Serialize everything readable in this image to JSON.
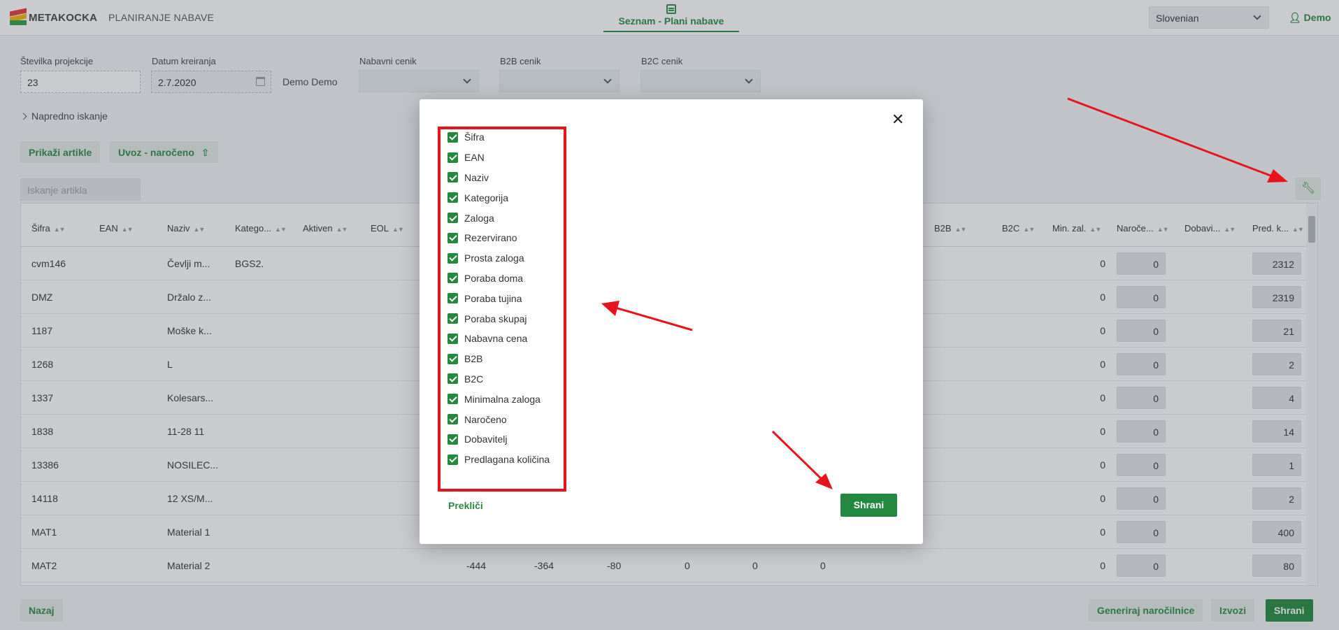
{
  "header": {
    "logo_text": "METAKOCKA",
    "app_title": "PLANIRANJE NABAVE",
    "nav_label": "Seznam - Plani nabave",
    "language": "Slovenian",
    "user": "Demo"
  },
  "filters": {
    "projection_label": "Številka projekcije",
    "projection_value": "23",
    "date_label": "Datum kreiranja",
    "date_value": "2.7.2020",
    "creator": "Demo Demo",
    "purchase_pricelist_label": "Nabavni cenik",
    "b2b_pricelist_label": "B2B cenik",
    "b2c_pricelist_label": "B2C cenik",
    "advanced_search": "Napredno iskanje"
  },
  "actions": {
    "show_items": "Prikaži artikle",
    "import_ordered": "Uvoz - naročeno",
    "search_placeholder": "Iskanje artikla"
  },
  "table": {
    "headers": [
      "Šifra",
      "EAN",
      "Naziv",
      "Katego...",
      "Aktiven",
      "EOL",
      "B2B",
      "B2C",
      "Min. zal.",
      "Naroče...",
      "Dobavi...",
      "Pred. k..."
    ],
    "rows": [
      {
        "sifra": "cvm146",
        "naziv": "Čevlji m...",
        "kategorija": "BGS2.",
        "min": "0",
        "naroceno": "0",
        "pred": "2312"
      },
      {
        "sifra": "DMZ",
        "naziv": "Držalo z...",
        "kategorija": "",
        "min": "0",
        "naroceno": "0",
        "pred": "2319"
      },
      {
        "sifra": "1187",
        "naziv": "Moške k...",
        "kategorija": "",
        "min": "0",
        "naroceno": "0",
        "pred": "21"
      },
      {
        "sifra": "1268",
        "naziv": "L",
        "kategorija": "",
        "min": "0",
        "naroceno": "0",
        "pred": "2"
      },
      {
        "sifra": "1337",
        "naziv": "Kolesars...",
        "kategorija": "",
        "min": "0",
        "naroceno": "0",
        "pred": "4"
      },
      {
        "sifra": "1838",
        "naziv": "11-28 11",
        "kategorija": "",
        "min": "0",
        "naroceno": "0",
        "pred": "14"
      },
      {
        "sifra": "13386",
        "naziv": "NOSILEC...",
        "kategorija": "",
        "min": "0",
        "naroceno": "0",
        "pred": "1"
      },
      {
        "sifra": "14118",
        "naziv": "12 XS/M...",
        "kategorija": "",
        "min": "0",
        "naroceno": "0",
        "pred": "2"
      },
      {
        "sifra": "MAT1",
        "naziv": "Material 1",
        "kategorija": "",
        "min": "0",
        "naroceno": "0",
        "pred": "400"
      },
      {
        "sifra": "MAT2",
        "naziv": "Material 2",
        "kategorija": "",
        "min": "0",
        "naroceno": "0",
        "pred": "80"
      }
    ],
    "mat2_extra": [
      "-444",
      "-364",
      "-80",
      "0",
      "0",
      "0"
    ]
  },
  "footer": {
    "back": "Nazaj",
    "generate_orders": "Generiraj naročilnice",
    "export": "Izvozi",
    "save": "Shrani"
  },
  "modal": {
    "columns": [
      "Šifra",
      "EAN",
      "Naziv",
      "Kategorija",
      "Zaloga",
      "Rezervirano",
      "Prosta zaloga",
      "Poraba doma",
      "Poraba tujina",
      "Poraba skupaj",
      "Nabavna cena",
      "B2B",
      "B2C",
      "Minimalna zaloga",
      "Naročeno",
      "Dobavitelj",
      "Predlagana količina"
    ],
    "cancel": "Prekliči",
    "save": "Shrani"
  },
  "colors": {
    "accent": "#2a8a43",
    "annotation": "#e8141b"
  }
}
